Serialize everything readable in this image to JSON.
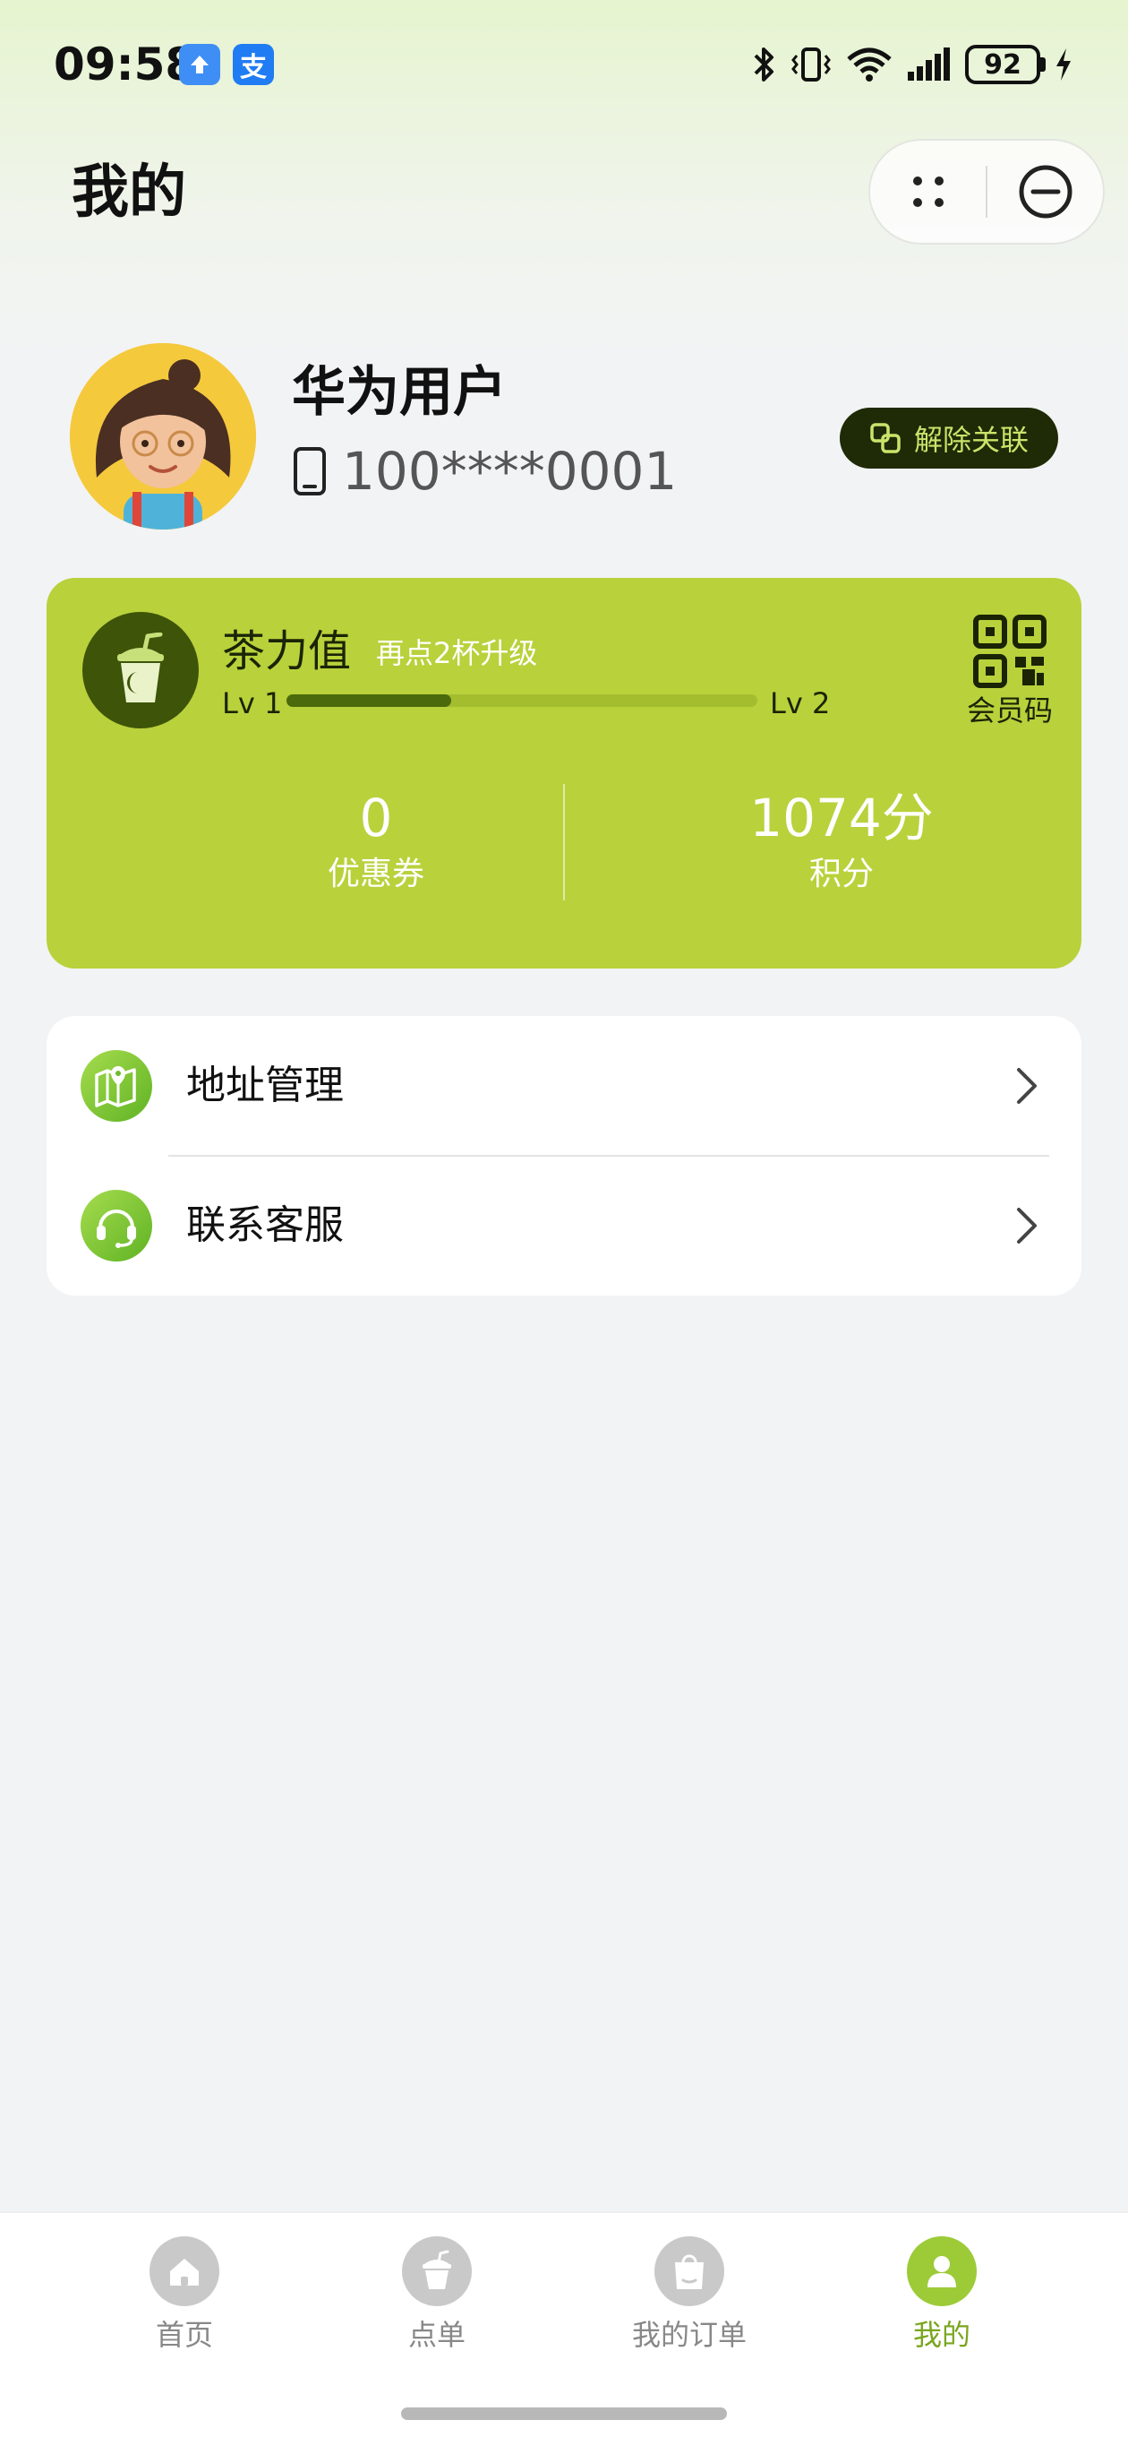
{
  "status_bar": {
    "time": "09:58",
    "app_icon_1": "upload-arrow-icon",
    "app_icon_2_text": "支",
    "battery": "92"
  },
  "header": {
    "title": "我的"
  },
  "profile": {
    "name": "华为用户",
    "phone": "100****0001",
    "unlink_label": "解除关联"
  },
  "membership": {
    "title": "茶力值",
    "subtitle": "再点2杯升级",
    "level_start": "Lv 1",
    "level_end": "Lv 2",
    "progress_fraction": 0.35,
    "qr_label": "会员码",
    "coupons_value": "0",
    "coupons_label": "优惠券",
    "points_value": "1074分",
    "points_label": "积分"
  },
  "menu": [
    {
      "label": "地址管理",
      "icon": "map-location-icon"
    },
    {
      "label": "联系客服",
      "icon": "headset-icon"
    }
  ],
  "tabs": [
    {
      "label": "首页",
      "icon": "home-icon",
      "active": false
    },
    {
      "label": "点单",
      "icon": "drink-cup-icon",
      "active": false
    },
    {
      "label": "我的订单",
      "icon": "shopping-bag-icon",
      "active": false
    },
    {
      "label": "我的",
      "icon": "user-icon",
      "active": true
    }
  ],
  "colors": {
    "card_green": "#b9d13b",
    "accent_green": "#9ccb37",
    "dark_green": "#3d5409",
    "unlink_bg": "#1f2a06"
  }
}
